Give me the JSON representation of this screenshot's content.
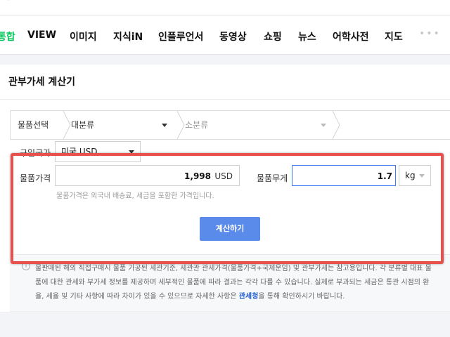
{
  "nav": {
    "tabs": [
      "통합",
      "VIEW",
      "이미지",
      "지식iN",
      "인플루언서",
      "동영상",
      "쇼핑",
      "뉴스",
      "어학사전",
      "지도"
    ],
    "more": "•••"
  },
  "card": {
    "title": "관부가세 계산기",
    "breadcrumb": [
      "물품선택",
      "대분류",
      "소분류"
    ]
  },
  "form": {
    "country_label": "구입국가",
    "country_value": "미국 USD",
    "price_label": "물품가격",
    "price_value": "1,998",
    "price_unit": "USD",
    "weight_label": "물품무게",
    "weight_value": "1.7",
    "weight_unit": "kg",
    "hint": "물품가격은 외국내 배송료, 세금을 포함한 가격입니다.",
    "calc_button": "계산하기"
  },
  "notice": {
    "line1": "물판매된 해외 직접구매시 물품 가공된 세관기준, 세관관 관세가격(물품가격+국제운임) 및 관부가세는 참고용입니다. 각 분류별 대표 물",
    "line2": "품에 대한 관세와 부가세 정보를 제공하며 세부적인 물품에 따라 결과는 각각 다를 수 있습니다. 실제로 부과되는 세금은 통관 시점의 환",
    "line3_pre": "율, 세율 및 기타 사항에 따라 차이가 있을 수 있으므로 자세한 사항은 ",
    "line3_link": "관세청",
    "line3_post": "을 통해 확인하시기 바랍니다."
  },
  "colors": {
    "accent": "#03c75a",
    "button": "#5a8bea",
    "highlight": "#e8504c",
    "focus": "#3b7bf0"
  }
}
